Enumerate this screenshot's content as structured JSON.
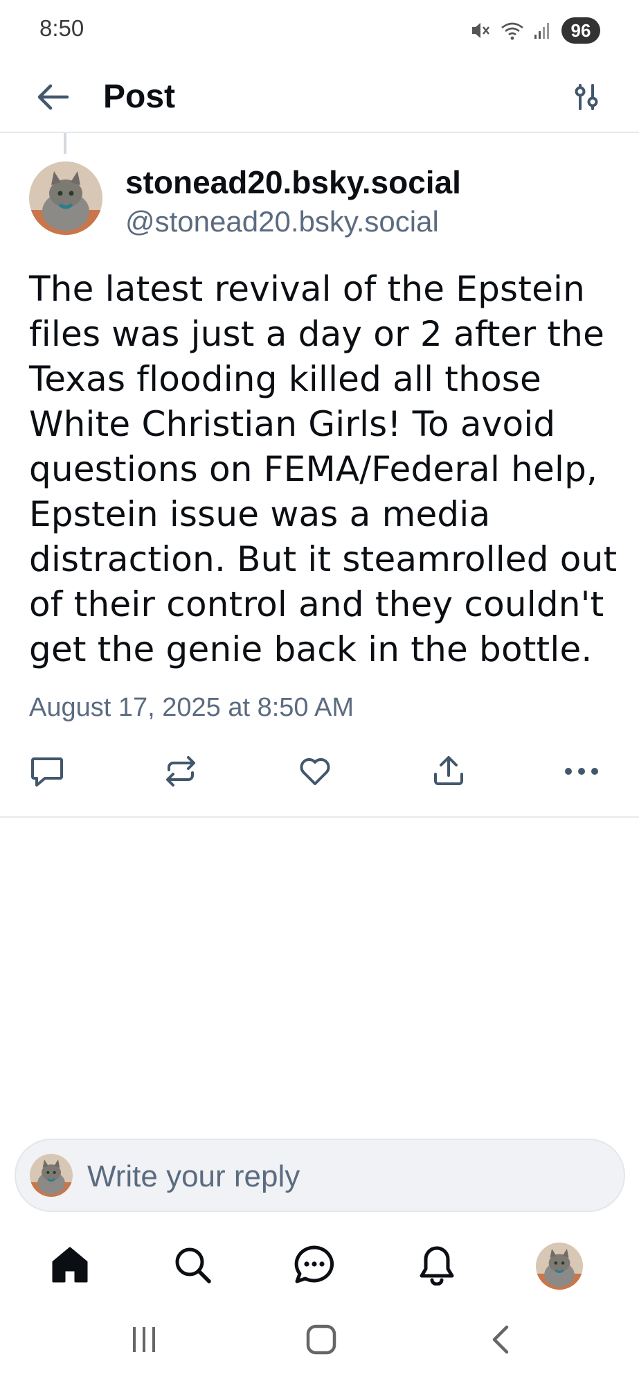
{
  "status_bar": {
    "time": "8:50",
    "battery": "96",
    "icons": [
      "mute-icon",
      "wifi-icon",
      "signal-icon"
    ]
  },
  "header": {
    "title": "Post",
    "back_icon": "arrow-left-icon",
    "filter_icon": "sliders-icon"
  },
  "post": {
    "author_name": "stonead20.bsky.social",
    "author_handle": "@stonead20.bsky.social",
    "text": "The latest revival of the Epstein files was just a day or 2 after the Texas flooding killed all those White Christian Girls! To avoid questions on FEMA/Federal help, Epstein issue was a media distraction. But it steamrolled out of their control and they couldn't get the genie back in the bottle.",
    "date": "August 17, 2025 at 8:50 AM",
    "actions": [
      "reply-icon",
      "repost-icon",
      "like-icon",
      "share-icon",
      "more-icon"
    ]
  },
  "reply": {
    "placeholder": "Write your reply"
  },
  "bottom_nav": [
    "home-icon",
    "search-icon",
    "chat-icon",
    "notifications-icon",
    "profile-avatar"
  ],
  "system_nav": [
    "recents-icon",
    "home-button-icon",
    "back-icon"
  ],
  "colors": {
    "text": "#0b0f14",
    "muted": "#5b6b80",
    "icon": "#42576c",
    "divider": "#e6e9ee",
    "composer_bg": "#f0f2f5"
  }
}
